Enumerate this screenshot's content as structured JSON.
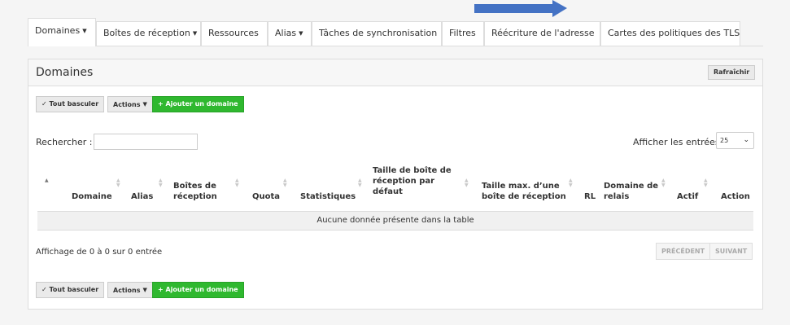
{
  "tabs": [
    {
      "label": "Domaines",
      "dropdown": true,
      "active": true
    },
    {
      "label": "Boîtes de réception",
      "dropdown": true
    },
    {
      "label": "Ressources"
    },
    {
      "label": "Alias",
      "dropdown": true
    },
    {
      "label": "Tâches de synchronisation"
    },
    {
      "label": "Filtres"
    },
    {
      "label": "Réécriture de l'adresse"
    },
    {
      "label": "Cartes des politiques des TLS"
    }
  ],
  "panel": {
    "title": "Domaines",
    "refresh_label": "Rafraîchir"
  },
  "toolbar": {
    "toggle_label": "Tout basculer",
    "actions_label": "Actions",
    "add_label": "+ Ajouter un domaine"
  },
  "search": {
    "label": "Rechercher :",
    "value": "",
    "placeholder": ""
  },
  "entries": {
    "label": "Afficher les entrées",
    "value": "25"
  },
  "table": {
    "columns": [
      "Domaine",
      "Alias",
      "Boîtes de réception",
      "Quota",
      "Statistiques",
      "Taille de boîte de réception par défaut",
      "Taille max. d’une boîte de réception",
      "RL",
      "Domaine de relais",
      "Actif",
      "Action"
    ],
    "empty_text": "Aucune donnée présente dans la table"
  },
  "pagination": {
    "info": "Affichage de 0 à 0 sur 0 entrée",
    "prev": "PRÉCÉDENT",
    "next": "SUIVANT"
  },
  "colors": {
    "accent_arrow": "#4472c4",
    "add_button": "#2fb82f"
  }
}
